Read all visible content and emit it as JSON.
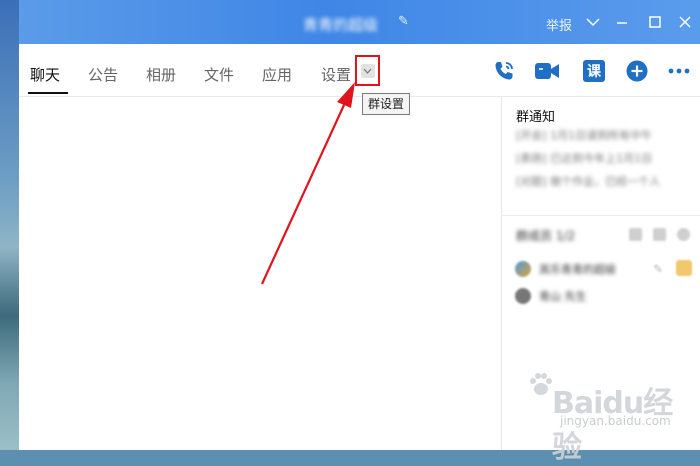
{
  "window": {
    "title": "青青的超级",
    "report_label": "举报"
  },
  "tabs": [
    {
      "label": "聊天",
      "active": true
    },
    {
      "label": "公告",
      "active": false
    },
    {
      "label": "相册",
      "active": false
    },
    {
      "label": "文件",
      "active": false
    },
    {
      "label": "应用",
      "active": false
    },
    {
      "label": "设置",
      "active": false
    }
  ],
  "tooltip": {
    "text": "群设置"
  },
  "toolbar_icons": [
    "phone-icon",
    "video-icon",
    "course-icon",
    "add-icon",
    "more-icon"
  ],
  "course_label": "课",
  "side_panel": {
    "notice_title": "群通知",
    "notices": [
      "[开会] 1月1日请到所有中午",
      "[表扬] 已达到今年上1月1日",
      "[对题] 做个作业，已经一个人"
    ],
    "members_title": "群成员 1/2",
    "members": [
      "其乐青青的超级",
      "青山 先生"
    ]
  },
  "watermark": {
    "brand": "Baidu经验",
    "url": "jingyan.baidu.com"
  },
  "colors": {
    "titlebar": "#3f86e6",
    "accent_icon": "#1f6fc5",
    "highlight_red": "#e0141c"
  }
}
